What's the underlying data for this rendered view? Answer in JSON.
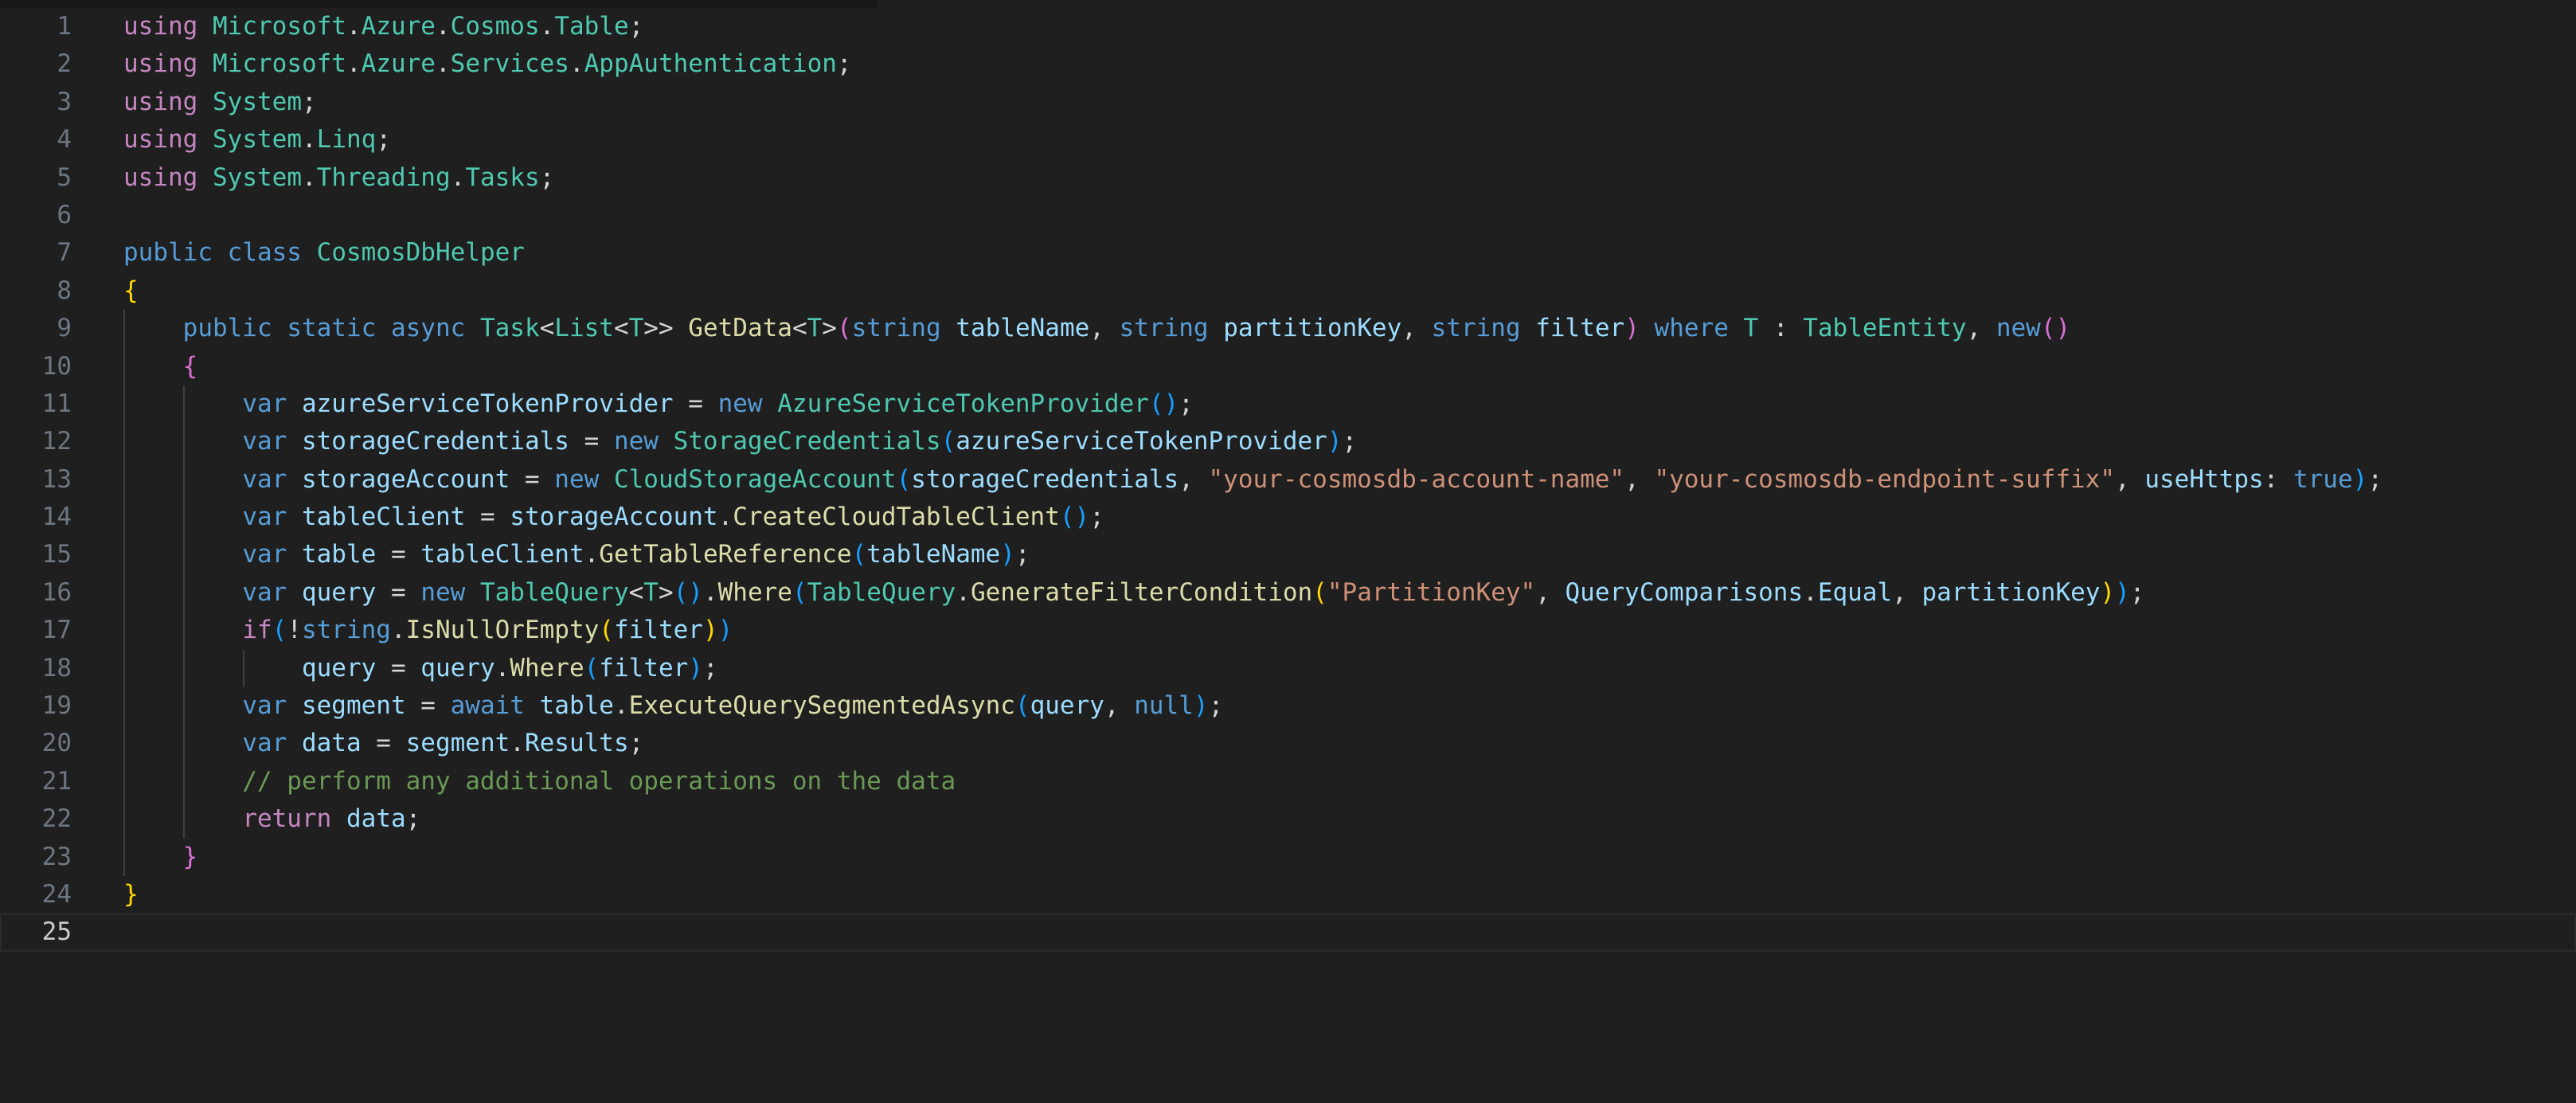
{
  "editor": {
    "current_line": 25,
    "lines": [
      {
        "n": "1",
        "indent": 0,
        "tokens": [
          [
            "using",
            "ctrl"
          ],
          [
            " ",
            "pun"
          ],
          [
            "Microsoft",
            "type"
          ],
          [
            ".",
            "pun"
          ],
          [
            "Azure",
            "type"
          ],
          [
            ".",
            "pun"
          ],
          [
            "Cosmos",
            "type"
          ],
          [
            ".",
            "pun"
          ],
          [
            "Table",
            "type"
          ],
          [
            ";",
            "pun"
          ]
        ]
      },
      {
        "n": "2",
        "indent": 0,
        "tokens": [
          [
            "using",
            "ctrl"
          ],
          [
            " ",
            "pun"
          ],
          [
            "Microsoft",
            "type"
          ],
          [
            ".",
            "pun"
          ],
          [
            "Azure",
            "type"
          ],
          [
            ".",
            "pun"
          ],
          [
            "Services",
            "type"
          ],
          [
            ".",
            "pun"
          ],
          [
            "AppAuthentication",
            "type"
          ],
          [
            ";",
            "pun"
          ]
        ]
      },
      {
        "n": "3",
        "indent": 0,
        "tokens": [
          [
            "using",
            "ctrl"
          ],
          [
            " ",
            "pun"
          ],
          [
            "System",
            "type"
          ],
          [
            ";",
            "pun"
          ]
        ]
      },
      {
        "n": "4",
        "indent": 0,
        "tokens": [
          [
            "using",
            "ctrl"
          ],
          [
            " ",
            "pun"
          ],
          [
            "System",
            "type"
          ],
          [
            ".",
            "pun"
          ],
          [
            "Linq",
            "type"
          ],
          [
            ";",
            "pun"
          ]
        ]
      },
      {
        "n": "5",
        "indent": 0,
        "tokens": [
          [
            "using",
            "ctrl"
          ],
          [
            " ",
            "pun"
          ],
          [
            "System",
            "type"
          ],
          [
            ".",
            "pun"
          ],
          [
            "Threading",
            "type"
          ],
          [
            ".",
            "pun"
          ],
          [
            "Tasks",
            "type"
          ],
          [
            ";",
            "pun"
          ]
        ]
      },
      {
        "n": "6",
        "indent": 0,
        "tokens": []
      },
      {
        "n": "7",
        "indent": 0,
        "tokens": [
          [
            "public",
            "kw"
          ],
          [
            " ",
            "pun"
          ],
          [
            "class",
            "kw"
          ],
          [
            " ",
            "pun"
          ],
          [
            "CosmosDbHelper",
            "type"
          ]
        ]
      },
      {
        "n": "8",
        "indent": 0,
        "tokens": [
          [
            "{",
            "b1"
          ]
        ]
      },
      {
        "n": "9",
        "indent": 1,
        "tokens": [
          [
            "    ",
            "pun"
          ],
          [
            "public",
            "kw"
          ],
          [
            " ",
            "pun"
          ],
          [
            "static",
            "kw"
          ],
          [
            " ",
            "pun"
          ],
          [
            "async",
            "kw"
          ],
          [
            " ",
            "pun"
          ],
          [
            "Task",
            "type"
          ],
          [
            "<",
            "pun"
          ],
          [
            "List",
            "type"
          ],
          [
            "<",
            "pun"
          ],
          [
            "T",
            "type"
          ],
          [
            ">>",
            "pun"
          ],
          [
            " ",
            "pun"
          ],
          [
            "GetData",
            "fn"
          ],
          [
            "<",
            "pun"
          ],
          [
            "T",
            "type"
          ],
          [
            ">",
            "pun"
          ],
          [
            "(",
            "b2"
          ],
          [
            "string",
            "kw"
          ],
          [
            " ",
            "pun"
          ],
          [
            "tableName",
            "var"
          ],
          [
            ", ",
            "pun"
          ],
          [
            "string",
            "kw"
          ],
          [
            " ",
            "pun"
          ],
          [
            "partitionKey",
            "var"
          ],
          [
            ", ",
            "pun"
          ],
          [
            "string",
            "kw"
          ],
          [
            " ",
            "pun"
          ],
          [
            "filter",
            "var"
          ],
          [
            ")",
            "b2"
          ],
          [
            " ",
            "pun"
          ],
          [
            "where",
            "kw"
          ],
          [
            " ",
            "pun"
          ],
          [
            "T",
            "type"
          ],
          [
            " : ",
            "pun"
          ],
          [
            "TableEntity",
            "type"
          ],
          [
            ", ",
            "pun"
          ],
          [
            "new",
            "kw"
          ],
          [
            "()",
            "b2"
          ]
        ]
      },
      {
        "n": "10",
        "indent": 1,
        "tokens": [
          [
            "    ",
            "pun"
          ],
          [
            "{",
            "b2"
          ]
        ]
      },
      {
        "n": "11",
        "indent": 2,
        "tokens": [
          [
            "        ",
            "pun"
          ],
          [
            "var",
            "kw"
          ],
          [
            " ",
            "pun"
          ],
          [
            "azureServiceTokenProvider",
            "var"
          ],
          [
            " = ",
            "pun"
          ],
          [
            "new",
            "kw"
          ],
          [
            " ",
            "pun"
          ],
          [
            "AzureServiceTokenProvider",
            "type"
          ],
          [
            "()",
            "b3"
          ],
          [
            ";",
            "pun"
          ]
        ]
      },
      {
        "n": "12",
        "indent": 2,
        "tokens": [
          [
            "        ",
            "pun"
          ],
          [
            "var",
            "kw"
          ],
          [
            " ",
            "pun"
          ],
          [
            "storageCredentials",
            "var"
          ],
          [
            " = ",
            "pun"
          ],
          [
            "new",
            "kw"
          ],
          [
            " ",
            "pun"
          ],
          [
            "StorageCredentials",
            "type"
          ],
          [
            "(",
            "b3"
          ],
          [
            "azureServiceTokenProvider",
            "var"
          ],
          [
            ")",
            "b3"
          ],
          [
            ";",
            "pun"
          ]
        ]
      },
      {
        "n": "13",
        "indent": 2,
        "tokens": [
          [
            "        ",
            "pun"
          ],
          [
            "var",
            "kw"
          ],
          [
            " ",
            "pun"
          ],
          [
            "storageAccount",
            "var"
          ],
          [
            " = ",
            "pun"
          ],
          [
            "new",
            "kw"
          ],
          [
            " ",
            "pun"
          ],
          [
            "CloudStorageAccount",
            "type"
          ],
          [
            "(",
            "b3"
          ],
          [
            "storageCredentials",
            "var"
          ],
          [
            ", ",
            "pun"
          ],
          [
            "\"your-cosmosdb-account-name\"",
            "str"
          ],
          [
            ", ",
            "pun"
          ],
          [
            "\"your-cosmosdb-endpoint-suffix\"",
            "str"
          ],
          [
            ", ",
            "pun"
          ],
          [
            "useHttps",
            "var"
          ],
          [
            ": ",
            "pun"
          ],
          [
            "true",
            "kw"
          ],
          [
            ")",
            "b3"
          ],
          [
            ";",
            "pun"
          ]
        ]
      },
      {
        "n": "14",
        "indent": 2,
        "tokens": [
          [
            "        ",
            "pun"
          ],
          [
            "var",
            "kw"
          ],
          [
            " ",
            "pun"
          ],
          [
            "tableClient",
            "var"
          ],
          [
            " = ",
            "pun"
          ],
          [
            "storageAccount",
            "var"
          ],
          [
            ".",
            "pun"
          ],
          [
            "CreateCloudTableClient",
            "fn"
          ],
          [
            "()",
            "b3"
          ],
          [
            ";",
            "pun"
          ]
        ]
      },
      {
        "n": "15",
        "indent": 2,
        "tokens": [
          [
            "        ",
            "pun"
          ],
          [
            "var",
            "kw"
          ],
          [
            " ",
            "pun"
          ],
          [
            "table",
            "var"
          ],
          [
            " = ",
            "pun"
          ],
          [
            "tableClient",
            "var"
          ],
          [
            ".",
            "pun"
          ],
          [
            "GetTableReference",
            "fn"
          ],
          [
            "(",
            "b3"
          ],
          [
            "tableName",
            "var"
          ],
          [
            ")",
            "b3"
          ],
          [
            ";",
            "pun"
          ]
        ]
      },
      {
        "n": "16",
        "indent": 2,
        "tokens": [
          [
            "        ",
            "pun"
          ],
          [
            "var",
            "kw"
          ],
          [
            " ",
            "pun"
          ],
          [
            "query",
            "var"
          ],
          [
            " = ",
            "pun"
          ],
          [
            "new",
            "kw"
          ],
          [
            " ",
            "pun"
          ],
          [
            "TableQuery",
            "type"
          ],
          [
            "<",
            "pun"
          ],
          [
            "T",
            "type"
          ],
          [
            ">",
            "pun"
          ],
          [
            "()",
            "b3"
          ],
          [
            ".",
            "pun"
          ],
          [
            "Where",
            "fn"
          ],
          [
            "(",
            "b3"
          ],
          [
            "TableQuery",
            "type"
          ],
          [
            ".",
            "pun"
          ],
          [
            "GenerateFilterCondition",
            "fn"
          ],
          [
            "(",
            "b1"
          ],
          [
            "\"PartitionKey\"",
            "str"
          ],
          [
            ", ",
            "pun"
          ],
          [
            "QueryComparisons",
            "var"
          ],
          [
            ".",
            "pun"
          ],
          [
            "Equal",
            "var"
          ],
          [
            ", ",
            "pun"
          ],
          [
            "partitionKey",
            "var"
          ],
          [
            ")",
            "b1"
          ],
          [
            ")",
            "b3"
          ],
          [
            ";",
            "pun"
          ]
        ]
      },
      {
        "n": "17",
        "indent": 2,
        "tokens": [
          [
            "        ",
            "pun"
          ],
          [
            "if",
            "ctrl"
          ],
          [
            "(",
            "b3"
          ],
          [
            "!",
            "pun"
          ],
          [
            "string",
            "kw"
          ],
          [
            ".",
            "pun"
          ],
          [
            "IsNullOrEmpty",
            "fn"
          ],
          [
            "(",
            "b1"
          ],
          [
            "filter",
            "var"
          ],
          [
            ")",
            "b1"
          ],
          [
            ")",
            "b3"
          ]
        ]
      },
      {
        "n": "18",
        "indent": 3,
        "tokens": [
          [
            "            ",
            "pun"
          ],
          [
            "query",
            "var"
          ],
          [
            " = ",
            "pun"
          ],
          [
            "query",
            "var"
          ],
          [
            ".",
            "pun"
          ],
          [
            "Where",
            "fn"
          ],
          [
            "(",
            "b3"
          ],
          [
            "filter",
            "var"
          ],
          [
            ")",
            "b3"
          ],
          [
            ";",
            "pun"
          ]
        ]
      },
      {
        "n": "19",
        "indent": 2,
        "tokens": [
          [
            "        ",
            "pun"
          ],
          [
            "var",
            "kw"
          ],
          [
            " ",
            "pun"
          ],
          [
            "segment",
            "var"
          ],
          [
            " = ",
            "pun"
          ],
          [
            "await",
            "kw"
          ],
          [
            " ",
            "pun"
          ],
          [
            "table",
            "var"
          ],
          [
            ".",
            "pun"
          ],
          [
            "ExecuteQuerySegmentedAsync",
            "fn"
          ],
          [
            "(",
            "b3"
          ],
          [
            "query",
            "var"
          ],
          [
            ", ",
            "pun"
          ],
          [
            "null",
            "kw"
          ],
          [
            ")",
            "b3"
          ],
          [
            ";",
            "pun"
          ]
        ]
      },
      {
        "n": "20",
        "indent": 2,
        "tokens": [
          [
            "        ",
            "pun"
          ],
          [
            "var",
            "kw"
          ],
          [
            " ",
            "pun"
          ],
          [
            "data",
            "var"
          ],
          [
            " = ",
            "pun"
          ],
          [
            "segment",
            "var"
          ],
          [
            ".",
            "pun"
          ],
          [
            "Results",
            "var"
          ],
          [
            ";",
            "pun"
          ]
        ]
      },
      {
        "n": "21",
        "indent": 2,
        "tokens": [
          [
            "        ",
            "pun"
          ],
          [
            "// perform any additional operations on the data",
            "com"
          ]
        ]
      },
      {
        "n": "22",
        "indent": 2,
        "tokens": [
          [
            "        ",
            "pun"
          ],
          [
            "return",
            "ctrl"
          ],
          [
            " ",
            "pun"
          ],
          [
            "data",
            "var"
          ],
          [
            ";",
            "pun"
          ]
        ]
      },
      {
        "n": "23",
        "indent": 1,
        "tokens": [
          [
            "    ",
            "pun"
          ],
          [
            "}",
            "b2"
          ]
        ]
      },
      {
        "n": "24",
        "indent": 0,
        "tokens": [
          [
            "}",
            "b1"
          ]
        ]
      },
      {
        "n": "25",
        "indent": 0,
        "tokens": []
      }
    ]
  },
  "colors": {
    "background": "#1f1f1f",
    "keyword": "#569cd6",
    "control": "#c586c0",
    "type": "#4ec9b0",
    "function": "#dcdcaa",
    "variable": "#9cdcfe",
    "string": "#ce9178",
    "comment": "#6a9955",
    "line_number": "#6e7681"
  }
}
